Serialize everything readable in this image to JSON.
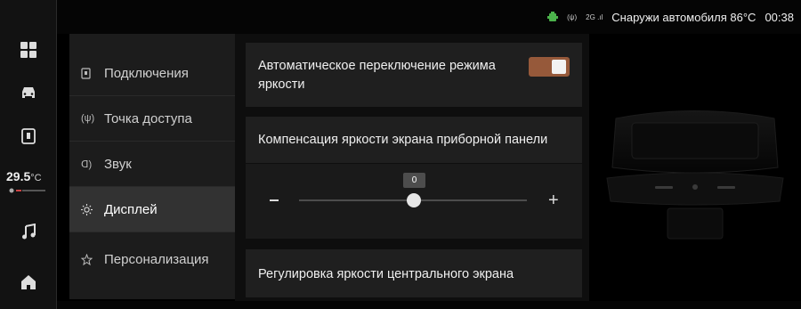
{
  "status_bar": {
    "wireless_label": "(ψ)",
    "network_label": "2G .ıl",
    "outside_temp_text": "Снаружи автомобиля 86°C",
    "time": "00:38"
  },
  "dock": {
    "temperature_value": "29.5",
    "temperature_unit": "°C"
  },
  "menu": {
    "items": [
      {
        "label": "Подключения",
        "icon": "phone-icon"
      },
      {
        "label": "Точка доступа",
        "icon": "hotspot-icon"
      },
      {
        "label": "Звук",
        "icon": "speaker-icon"
      },
      {
        "label": "Дисплей",
        "icon": "sun-icon"
      },
      {
        "label": "Персонализация",
        "icon": "star-icon"
      }
    ],
    "icon_text": {
      "hotspot": "(ψ)",
      "speaker": "ᗡ)"
    },
    "active_index": 3
  },
  "content": {
    "auto_brightness_label": "Автоматическое переключение режима яркости",
    "auto_brightness_on": true,
    "cluster_comp_label": "Компенсация яркости экрана приборной панели",
    "slider_value": "0",
    "slider_minus": "−",
    "slider_plus": "+",
    "center_brightness_label": "Регулировка яркости центрального экрана"
  },
  "colors": {
    "toggle_on": "#96593a",
    "active_menu_bg": "#323232",
    "card_bg": "#1f1f1f"
  }
}
